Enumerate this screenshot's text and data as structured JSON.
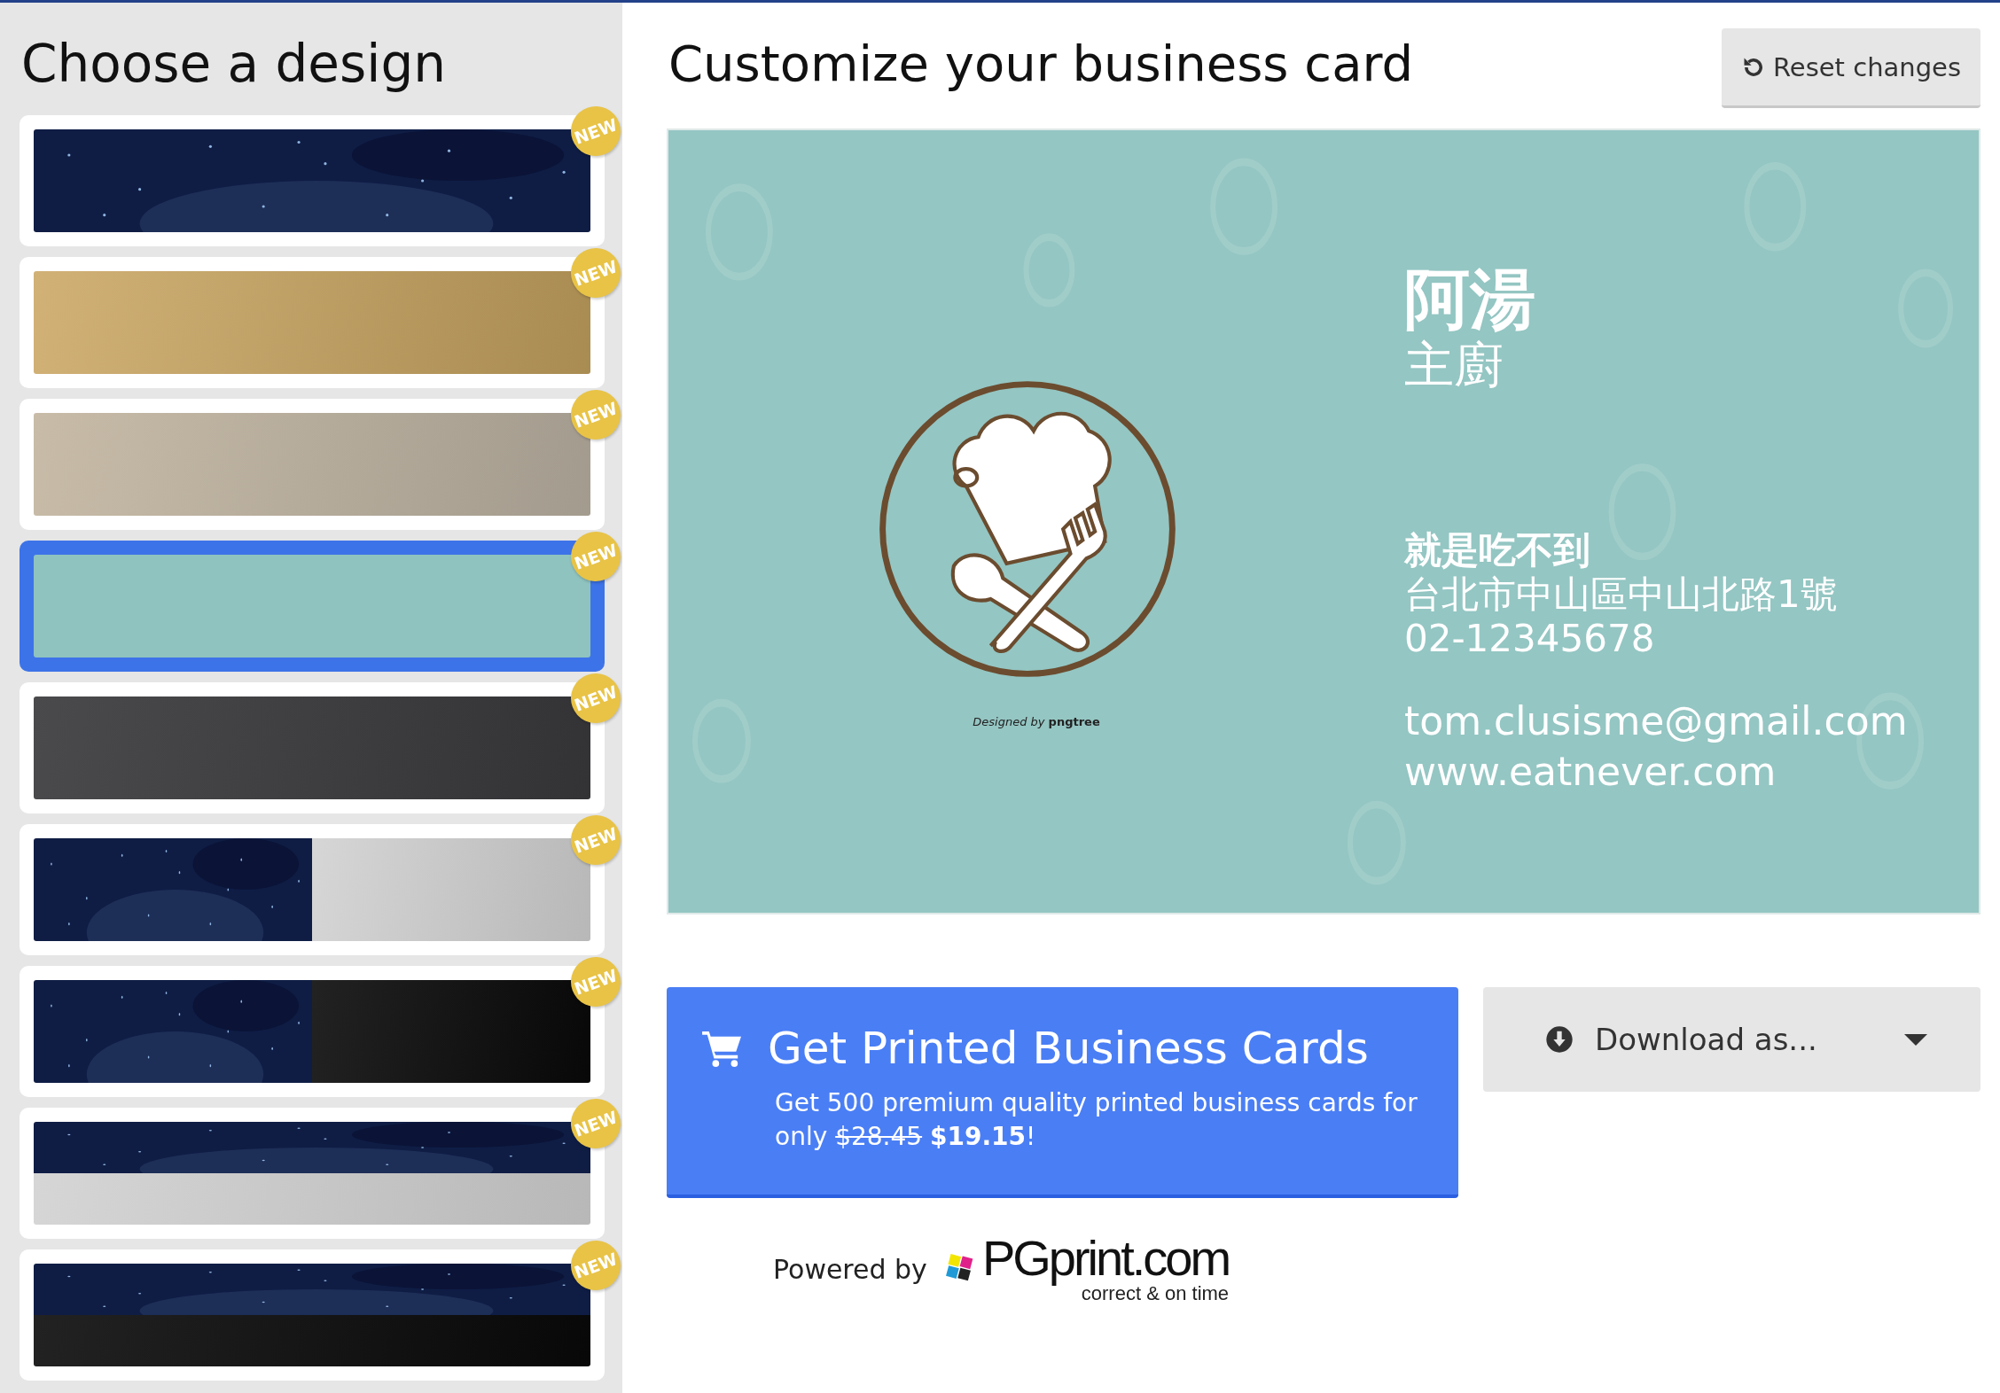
{
  "sidebar": {
    "title": "Choose a design",
    "designs": [
      {
        "kind": "space",
        "badge": "NEW",
        "selected": false
      },
      {
        "kind": "gold",
        "badge": "NEW",
        "selected": false
      },
      {
        "kind": "beige",
        "badge": "NEW",
        "selected": false
      },
      {
        "kind": "teal",
        "badge": "NEW",
        "selected": true
      },
      {
        "kind": "charcoal",
        "badge": "NEW",
        "selected": false
      },
      {
        "kind": "space-left-gray",
        "badge": "NEW",
        "selected": false
      },
      {
        "kind": "space-left-black",
        "badge": "NEW",
        "selected": false
      },
      {
        "kind": "space-top-gray",
        "badge": "NEW",
        "selected": false
      },
      {
        "kind": "space-top-black",
        "badge": "NEW",
        "selected": false
      }
    ]
  },
  "main": {
    "title": "Customize your business card",
    "reset_button": "Reset changes",
    "card": {
      "logo_credit_prefix": "Designed by",
      "logo_credit_brand": "pngtree",
      "name": "阿湯",
      "job_title": "主廚",
      "company": "就是吃不到",
      "address": "台北市中山區中山北路1號",
      "phone": "02-12345678",
      "email": "tom.clusisme@gmail.com",
      "website": "www.eatnever.com"
    },
    "print_button": {
      "title": "Get Printed Business Cards",
      "text_before": "Get 500 premium quality printed business cards for only",
      "old_price": "$28.45",
      "new_price": "$19.15",
      "text_after": "!"
    },
    "download_button": "Download as...",
    "powered_by": {
      "label": "Powered by",
      "brand": "PGprint.com",
      "tagline": "correct & on time"
    }
  }
}
